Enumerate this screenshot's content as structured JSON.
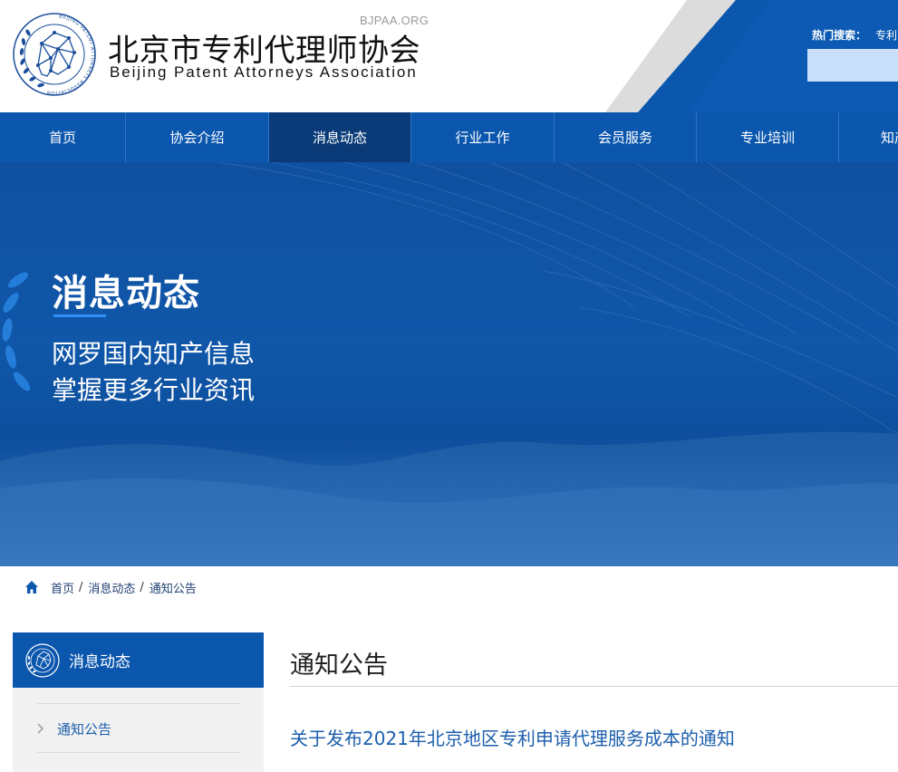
{
  "header": {
    "site_domain": "BJPAA.ORG",
    "title_cn": "北京市专利代理师协会",
    "title_en": "Beijing Patent Attorneys Association",
    "emblem_text": "BEIJING PATENT ATTORNEYS ASSOCIATION",
    "hot_search_label": "热门搜索：",
    "hot_search_keyword": "专利",
    "search_placeholder": ""
  },
  "nav": {
    "items": [
      {
        "label": "首页",
        "active": false
      },
      {
        "label": "协会介绍",
        "active": false
      },
      {
        "label": "消息动态",
        "active": true
      },
      {
        "label": "行业工作",
        "active": false
      },
      {
        "label": "会员服务",
        "active": false
      },
      {
        "label": "专业培训",
        "active": false
      },
      {
        "label": "知产",
        "active": false
      }
    ]
  },
  "banner": {
    "title": "消息动态",
    "subtitle_line1": "网罗国内知产信息",
    "subtitle_line2": "掌握更多行业资讯"
  },
  "breadcrumb": {
    "home": "首页",
    "level1": "消息动态",
    "current": "通知公告",
    "separator": "/"
  },
  "sidebar": {
    "title": "消息动态",
    "items": [
      {
        "label": "通知公告"
      }
    ]
  },
  "main": {
    "title": "通知公告",
    "article_title": "关于发布2021年北京地区专利申请代理服务成本的通知"
  },
  "colors": {
    "primary_blue": "#0c57ae",
    "nav_active": "#0a3b78",
    "link_blue": "#1d5fad",
    "sidebar_bg": "#f1f1f1"
  },
  "icons": [
    "home-icon",
    "chevron-right-icon",
    "association-emblem-icon",
    "laurel-icon"
  ]
}
